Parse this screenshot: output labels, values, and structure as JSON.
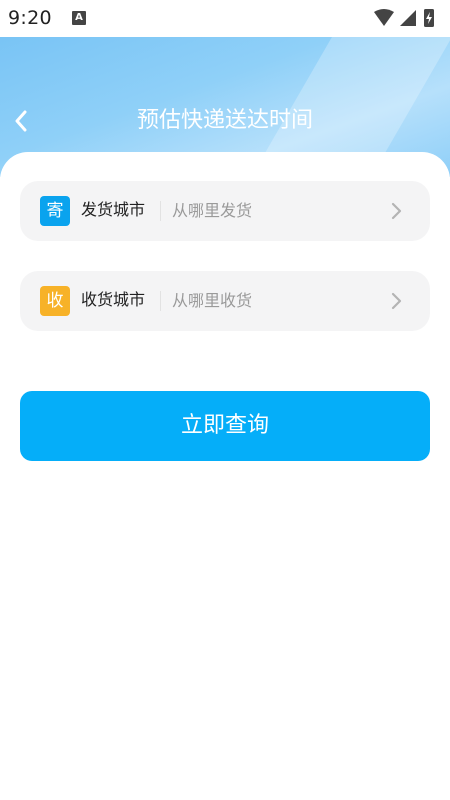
{
  "status_bar": {
    "time": "9:20",
    "notification_icon": "A"
  },
  "header": {
    "title": "预估快递送达时间",
    "back_icon": "chevron-left-icon"
  },
  "form": {
    "send": {
      "badge": "寄",
      "badge_color": "#0aa3ee",
      "label": "发货城市",
      "placeholder": "从哪里发货"
    },
    "receive": {
      "badge": "收",
      "badge_color": "#f7b228",
      "label": "收货城市",
      "placeholder": "从哪里收货"
    }
  },
  "actions": {
    "query_label": "立即查询",
    "query_color": "#05aef9"
  }
}
